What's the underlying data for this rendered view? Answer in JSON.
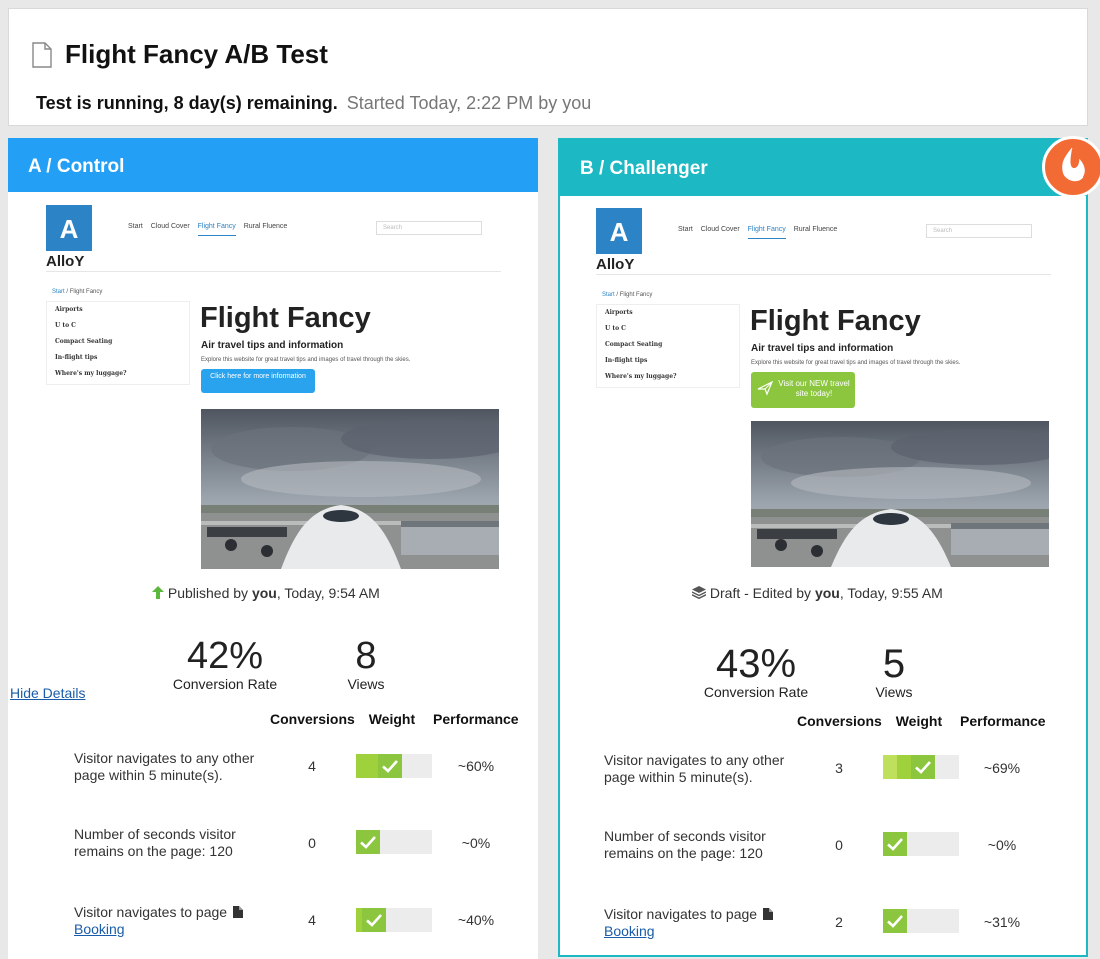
{
  "header": {
    "title": "Flight Fancy A/B Test",
    "status_bold": "Test is running, 8 day(s) remaining.",
    "status_started": "Started Today, 2:22 PM by you"
  },
  "variants": [
    {
      "title": "A / Control",
      "header_color": "#23a0f5",
      "meta_prefix": "Published by",
      "meta_user": "you",
      "meta_time": ", Today, 9:54 AM",
      "conversion_rate": "42%",
      "conversion_label": "Conversion Rate",
      "views": "8",
      "views_label": "Views",
      "rows": [
        {
          "conversions": "4",
          "weight": 0.6,
          "performance": "~60%"
        },
        {
          "conversions": "0",
          "weight": 0.0,
          "performance": "~0%"
        },
        {
          "conversions": "4",
          "weight": 0.4,
          "performance": "~40%"
        }
      ]
    },
    {
      "title": "B / Challenger",
      "header_color": "#1cb8c3",
      "meta_prefix": "Draft - Edited by",
      "meta_user": "you",
      "meta_time": ", Today, 9:55 AM",
      "conversion_rate": "43%",
      "conversion_label": "Conversion Rate",
      "views": "5",
      "views_label": "Views",
      "rows": [
        {
          "conversions": "3",
          "weight": 0.69,
          "performance": "~69%"
        },
        {
          "conversions": "0",
          "weight": 0.0,
          "performance": "~0%"
        },
        {
          "conversions": "2",
          "weight": 0.31,
          "performance": "~31%"
        }
      ]
    }
  ],
  "goals": [
    {
      "text": "Visitor navigates to any other page within 5 minute(s)."
    },
    {
      "text": "Number of seconds visitor remains on the page: 120"
    },
    {
      "text": "Visitor navigates to page",
      "link": "Booking"
    }
  ],
  "table_headers": {
    "conversions": "Conversions",
    "weight": "Weight",
    "performance": "Performance"
  },
  "hide_details": "Hide Details",
  "preview": {
    "logo_letter": "A",
    "logo_word": "AlloY",
    "nav": [
      "Start",
      "Cloud Cover",
      "Flight Fancy",
      "Rural Fluence"
    ],
    "search_placeholder": "Search",
    "breadcrumb_start": "Start",
    "breadcrumb_sep": "/",
    "breadcrumb_current": "Flight Fancy",
    "side_links": [
      "Airports",
      "U to C",
      "Compact Seating",
      "In-flight tips",
      "Where's my luggage?"
    ],
    "heading": "Flight Fancy",
    "subheading": "Air travel tips and information",
    "description": "Explore this website for great travel tips and images of travel through the skies.",
    "cta_a": "Click here for more information",
    "cta_b": "Visit our NEW travel site today!"
  }
}
